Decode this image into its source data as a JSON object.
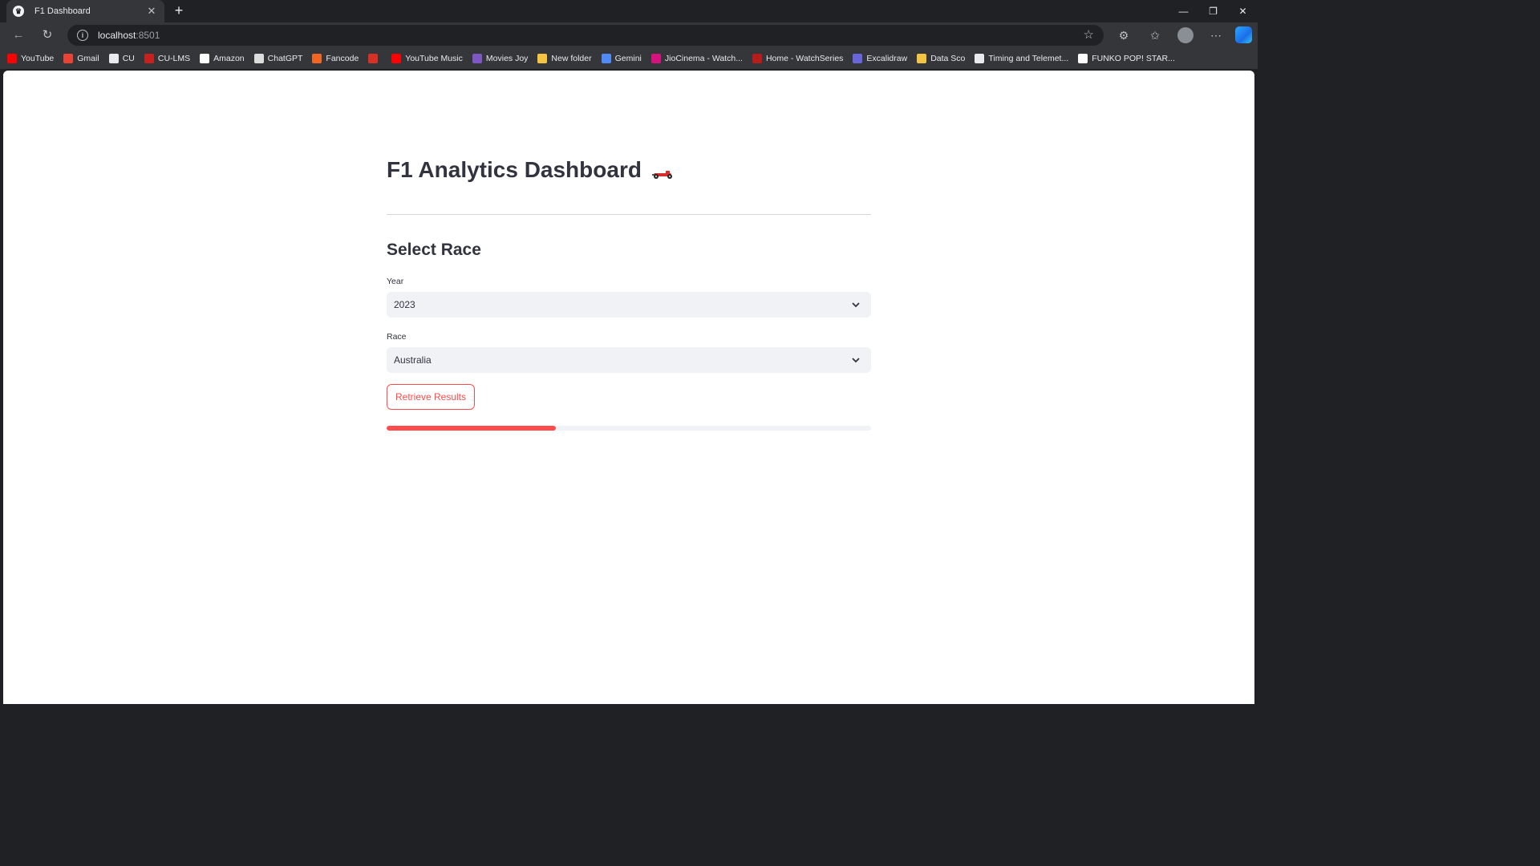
{
  "browser": {
    "tab_title": "F1 Dashboard",
    "url_host": "localhost",
    "url_port": ":8501",
    "bookmarks": [
      {
        "label": "YouTube",
        "color": "#ff0000"
      },
      {
        "label": "Gmail",
        "color": "#ea4335"
      },
      {
        "label": "CU",
        "color": "#e8eaed"
      },
      {
        "label": "CU-LMS",
        "color": "#c5221f"
      },
      {
        "label": "Amazon",
        "color": "#ffffff"
      },
      {
        "label": "ChatGPT",
        "color": "#dddddd"
      },
      {
        "label": "Fancode",
        "color": "#f26522"
      },
      {
        "label": "",
        "color": "#d93025"
      },
      {
        "label": "YouTube Music",
        "color": "#ff0000"
      },
      {
        "label": "Movies Joy",
        "color": "#7e57c2"
      },
      {
        "label": "New folder",
        "color": "#f4c542"
      },
      {
        "label": "Gemini",
        "color": "#4f8af5"
      },
      {
        "label": "JioCinema - Watch...",
        "color": "#d6127f"
      },
      {
        "label": "Home - WatchSeries",
        "color": "#b71c1c"
      },
      {
        "label": "Excalidraw",
        "color": "#6965db"
      },
      {
        "label": "Data Sco",
        "color": "#f4c542"
      },
      {
        "label": "Timing and Telemet...",
        "color": "#e8eaed"
      },
      {
        "label": "FUNKO POP! STAR...",
        "color": "#ffffff"
      }
    ]
  },
  "page": {
    "title": "F1 Analytics Dashboard",
    "section_title": "Select Race",
    "year": {
      "label": "Year",
      "value": "2023"
    },
    "race": {
      "label": "Race",
      "value": "Australia"
    },
    "button_label": "Retrieve Results",
    "progress": 0.35,
    "accent_color": "#ff4b4b"
  }
}
